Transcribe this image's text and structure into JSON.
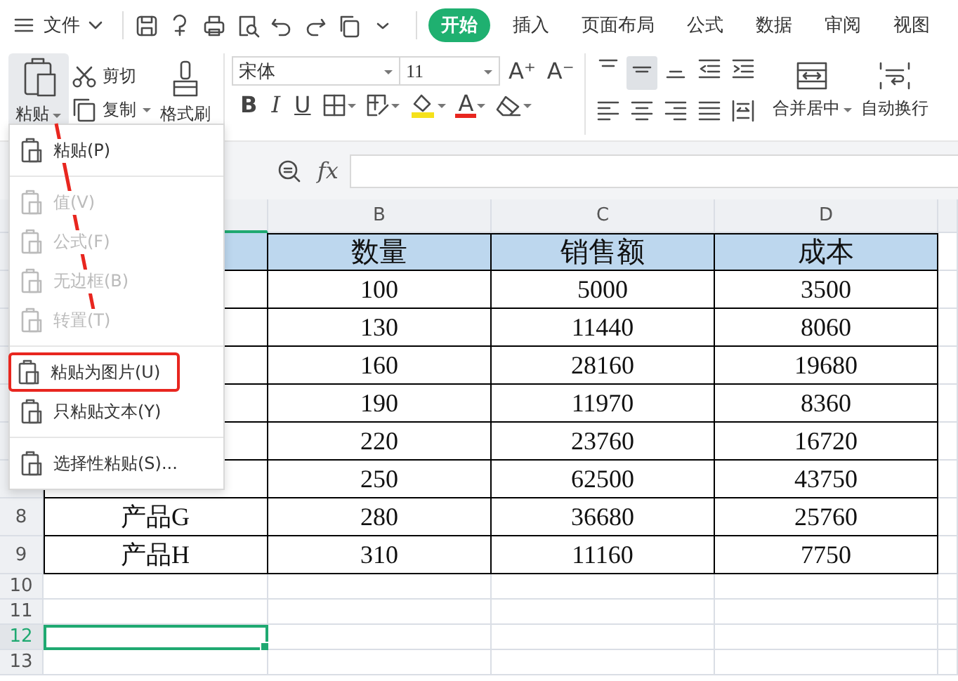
{
  "menu_bar": {
    "file_menu": "文件",
    "tabs": [
      {
        "label": "开始",
        "selected": true
      },
      {
        "label": "插入",
        "selected": false
      },
      {
        "label": "页面布局",
        "selected": false
      },
      {
        "label": "公式",
        "selected": false
      },
      {
        "label": "数据",
        "selected": false
      },
      {
        "label": "审阅",
        "selected": false
      },
      {
        "label": "视图",
        "selected": false
      }
    ]
  },
  "ribbon": {
    "paste": "粘贴",
    "cut": "剪切",
    "copy": "复制",
    "format_painter": "格式刷",
    "font_name": "宋体",
    "font_size": "11",
    "font_grow": "A⁺",
    "font_shrink": "A⁻",
    "bold": "B",
    "italic": "I",
    "underline": "U",
    "font_color": "A",
    "vertical_align_buttons": [
      {
        "selected": false
      },
      {
        "selected": true
      },
      {
        "selected": false
      }
    ],
    "merge_center": "合并居中",
    "wrap_text": "自动换行"
  },
  "formula_bar": {
    "fx": "fx"
  },
  "sheet": {
    "columns": [
      "B",
      "C",
      "D"
    ],
    "rows": [
      {
        "kind": "header",
        "selected": false,
        "values": [
          "数量",
          "销售额",
          "成本"
        ]
      },
      {
        "kind": "data",
        "selected": false,
        "values": [
          "100",
          "5000",
          "3500"
        ]
      },
      {
        "kind": "data",
        "selected": false,
        "values": [
          "130",
          "11440",
          "8060"
        ]
      },
      {
        "kind": "data",
        "selected": false,
        "values": [
          "160",
          "28160",
          "19680"
        ]
      },
      {
        "kind": "data",
        "selected": false,
        "values": [
          "190",
          "11970",
          "8360"
        ]
      },
      {
        "kind": "data",
        "selected": false,
        "values": [
          "220",
          "23760",
          "16720"
        ]
      },
      {
        "kind": "data",
        "selected": false,
        "values": [
          "250",
          "62500",
          "43750"
        ]
      },
      {
        "kind": "data",
        "selected": false,
        "number": "8",
        "label": "产品G",
        "values": [
          "280",
          "36680",
          "25760"
        ]
      },
      {
        "kind": "data",
        "selected": false,
        "number": "9",
        "label": "产品H",
        "values": [
          "310",
          "11160",
          "7750"
        ]
      },
      {
        "kind": "empty",
        "selected": false,
        "number": "10"
      },
      {
        "kind": "empty",
        "selected": false,
        "number": "11"
      },
      {
        "kind": "empty",
        "selected": true,
        "number": "12"
      },
      {
        "kind": "empty",
        "selected": false,
        "number": "13"
      }
    ]
  },
  "paste_menu": {
    "groups": [
      [
        {
          "label": "粘贴(P)",
          "disabled": false,
          "annotated": false
        }
      ],
      [
        {
          "label": "值(V)",
          "disabled": true,
          "annotated": false
        },
        {
          "label": "公式(F)",
          "disabled": true,
          "annotated": false
        },
        {
          "label": "无边框(B)",
          "disabled": true,
          "annotated": false
        },
        {
          "label": "转置(T)",
          "disabled": true,
          "annotated": false
        }
      ],
      [
        {
          "label": "粘贴为图片(U)",
          "disabled": false,
          "annotated": true
        },
        {
          "label": "只粘贴文本(Y)",
          "disabled": false,
          "annotated": false
        }
      ],
      [
        {
          "label": "选择性粘贴(S)...",
          "disabled": false,
          "annotated": false
        }
      ]
    ]
  }
}
